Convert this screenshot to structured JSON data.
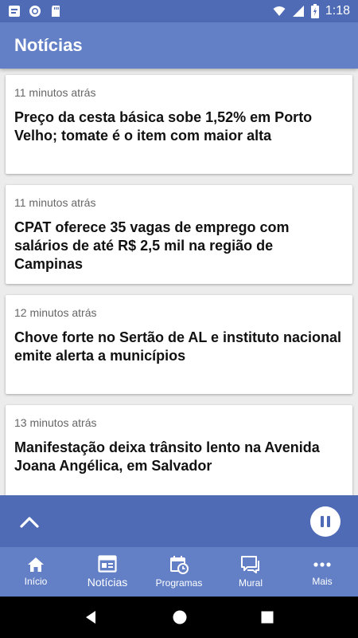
{
  "status_bar": {
    "time": "1:18",
    "icons": [
      "notification-icon",
      "record-icon",
      "sd-card-icon",
      "wifi-icon",
      "signal-icon",
      "battery-icon"
    ]
  },
  "app_bar": {
    "title": "Notícias"
  },
  "news": [
    {
      "time": "11 minutos atrás",
      "title": "Preço da cesta básica sobe 1,52% em Porto Velho; tomate é o item com maior alta"
    },
    {
      "time": "11 minutos atrás",
      "title": "CPAT oferece 35 vagas de emprego com salários de até R$ 2,5 mil na região de Campinas"
    },
    {
      "time": "12 minutos atrás",
      "title": "Chove forte no Sertão de AL e instituto nacional emite alerta a municípios"
    },
    {
      "time": "13 minutos atrás",
      "title": "Manifestação deixa trânsito lento na Avenida Joana Angélica, em Salvador"
    }
  ],
  "player": {
    "expand_icon": "chevron-up-icon",
    "control_icon": "pause-icon"
  },
  "bottom_nav": [
    {
      "label": "Início",
      "icon": "home-icon"
    },
    {
      "label": "Notícias",
      "icon": "news-icon",
      "active": true
    },
    {
      "label": "Programas",
      "icon": "calendar-clock-icon"
    },
    {
      "label": "Mural",
      "icon": "chat-icon"
    },
    {
      "label": "Mais",
      "icon": "more-icon"
    }
  ],
  "colors": {
    "status_bar": "#4f6bb5",
    "app_bar": "#6380c7",
    "player_bar": "#4f6bb5",
    "bottom_nav": "#6380c7",
    "background": "#ececec"
  }
}
